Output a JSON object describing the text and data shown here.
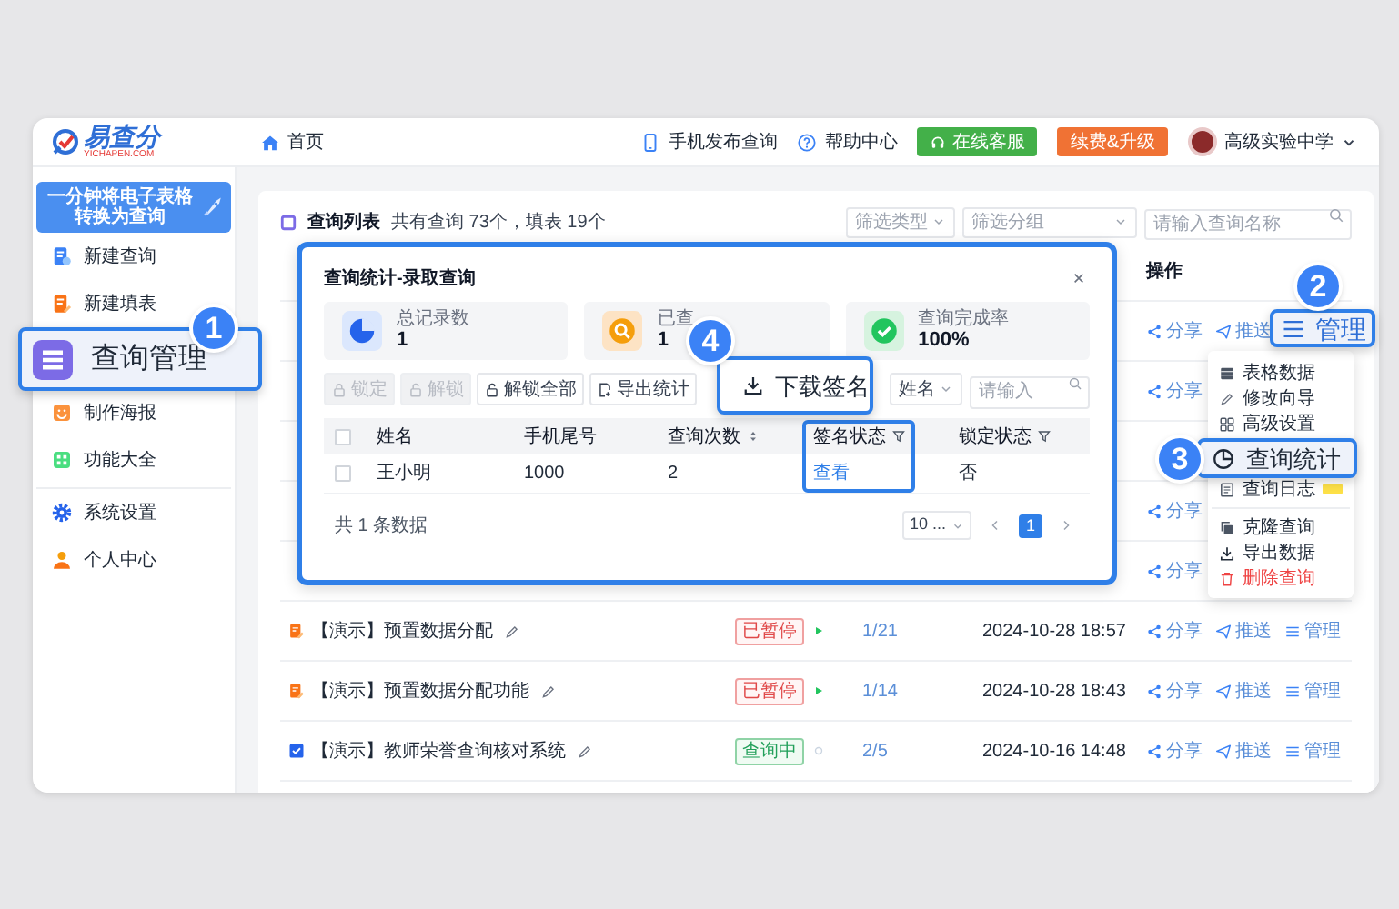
{
  "header": {
    "logo": {
      "name": "易查分",
      "domain": "YICHAPEN.COM"
    },
    "nav": [
      {
        "label": "首页"
      }
    ],
    "links": [
      {
        "label": "手机发布查询"
      },
      {
        "label": "帮助中心"
      }
    ],
    "buttons": [
      {
        "label": "在线客服",
        "kind": "support"
      },
      {
        "label": "续费&升级",
        "kind": "upgrade"
      }
    ],
    "account": {
      "name": "高级实验中学"
    }
  },
  "sidebar": {
    "banner": [
      "一分钟将电子表格",
      "转换为查询"
    ],
    "items": [
      {
        "label": "新建查询"
      },
      {
        "label": "新建填表"
      },
      {
        "label": "制作海报"
      },
      {
        "label": "功能大全"
      },
      {
        "label": "系统设置"
      },
      {
        "label": "个人中心"
      }
    ]
  },
  "query_list": {
    "title": "查询列表",
    "summary": "共有查询 73个，填表 19个",
    "filters": [
      {
        "placeholder": "筛选类型"
      },
      {
        "placeholder": "筛选分组"
      }
    ],
    "search": {
      "placeholder": "请输入查询名称"
    },
    "actions_header": "操作",
    "rows": [
      {
        "actions": [
          {
            "label": "分享",
            "kind": "share"
          },
          {
            "label": "推送",
            "kind": "push"
          }
        ]
      },
      {
        "actions": [
          {
            "label": "分享",
            "kind": "share"
          }
        ]
      },
      {},
      {
        "actions": [
          {
            "label": "分享",
            "kind": "share"
          }
        ]
      },
      {
        "actions": [
          {
            "label": "分享",
            "kind": "share"
          }
        ]
      },
      {
        "kind": "fill",
        "name": "【演示】预置数据分配",
        "status": "已暂停",
        "paused": true,
        "ratio": "1/21",
        "date": "2024-10-28 18:57",
        "actions": [
          {
            "label": "分享",
            "kind": "share"
          },
          {
            "label": "推送",
            "kind": "push"
          },
          {
            "label": "管理",
            "kind": "manage"
          }
        ]
      },
      {
        "kind": "fill",
        "name": "【演示】预置数据分配功能",
        "status": "已暂停",
        "paused": true,
        "ratio": "1/14",
        "date": "2024-10-28 18:43",
        "actions": [
          {
            "label": "分享",
            "kind": "share"
          },
          {
            "label": "推送",
            "kind": "push"
          },
          {
            "label": "管理",
            "kind": "manage"
          }
        ]
      },
      {
        "kind": "query",
        "name": "【演示】教师荣誉查询核对系统",
        "status": "查询中",
        "paused": false,
        "ratio": "2/5",
        "date": "2024-10-16 14:48",
        "actions": [
          {
            "label": "分享",
            "kind": "share"
          },
          {
            "label": "推送",
            "kind": "push"
          },
          {
            "label": "管理",
            "kind": "manage"
          }
        ]
      }
    ]
  },
  "modal": {
    "title": "查询统计-录取查询",
    "stats": [
      {
        "label": "总记录数",
        "value": "1"
      },
      {
        "label": "已查",
        "value": "1"
      },
      {
        "label": "查询完成率",
        "value": "100%"
      }
    ],
    "toolbar": [
      {
        "label": "锁定",
        "disabled": true
      },
      {
        "label": "解锁",
        "disabled": true
      },
      {
        "label": "解锁全部",
        "disabled": false
      },
      {
        "label": "导出统计",
        "disabled": false
      }
    ],
    "field_select": "姓名",
    "search_placeholder": "请输入",
    "select_all": {
      "checked": false
    },
    "columns": [
      {
        "label": "姓名",
        "kind": "text",
        "sort": false,
        "filter": false,
        "highlighted": false
      },
      {
        "label": "手机尾号",
        "kind": "text",
        "sort": false,
        "filter": false,
        "highlighted": false
      },
      {
        "label": "查询次数",
        "kind": "text",
        "sort": true,
        "filter": false,
        "highlighted": false
      },
      {
        "label": "签名状态",
        "kind": "link",
        "sort": false,
        "filter": true,
        "highlighted": true
      },
      {
        "label": "锁定状态",
        "kind": "text",
        "sort": false,
        "filter": true,
        "highlighted": false
      }
    ],
    "rows": [
      {
        "checked": false,
        "cells": [
          "王小明",
          "1000",
          "2",
          "查看",
          "否"
        ]
      }
    ],
    "total": "共 1 条数据",
    "page_size": "10 ...",
    "pages": [
      {
        "label": "1",
        "selected": true
      }
    ]
  },
  "menu": {
    "items": [
      {
        "label": "表格数据",
        "danger": false,
        "badge": false
      },
      {
        "label": "修改向导",
        "danger": false,
        "badge": false
      },
      {
        "label": "高级设置",
        "danger": false,
        "badge": false
      },
      {
        "label": "查询日志",
        "danger": false,
        "badge": true
      },
      {
        "label": "克隆查询",
        "danger": false,
        "badge": false
      },
      {
        "label": "导出数据",
        "danger": false,
        "badge": false
      },
      {
        "label": "删除查询",
        "danger": true,
        "badge": false
      }
    ]
  },
  "callouts": [
    {
      "number": "1",
      "label": "查询管理"
    },
    {
      "number": "2",
      "label": "管理"
    },
    {
      "number": "3",
      "label": "查询统计"
    },
    {
      "number": "4",
      "label": "下载签名"
    }
  ]
}
